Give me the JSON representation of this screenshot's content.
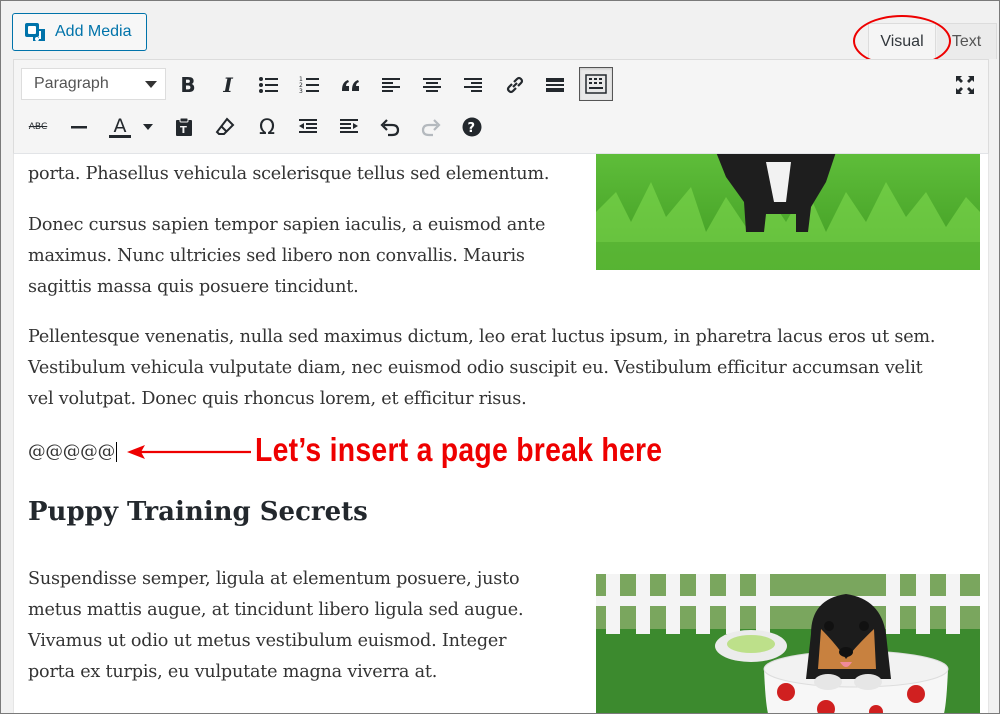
{
  "add_media": {
    "label": "Add Media",
    "icon": "media-icon"
  },
  "tabs": [
    {
      "label": "Visual",
      "active": true
    },
    {
      "label": "Text",
      "active": false
    }
  ],
  "toolbar": {
    "format_select": "Paragraph",
    "row1_icons": [
      "bold-icon",
      "italic-icon",
      "bulleted-list-icon",
      "numbered-list-icon",
      "blockquote-icon",
      "align-left-icon",
      "align-center-icon",
      "align-right-icon",
      "link-icon",
      "read-more-icon",
      "toolbar-toggle-icon",
      "fullscreen-icon"
    ],
    "row2_icons": [
      "strikethrough-icon",
      "horizontal-line-icon",
      "text-color-icon",
      "paste-as-text-icon",
      "clear-formatting-icon",
      "special-character-icon",
      "outdent-icon",
      "indent-icon",
      "undo-icon",
      "redo-icon",
      "help-icon"
    ],
    "labels": {
      "bold": "B",
      "italic": "I",
      "text_color": "A",
      "special_char": "Ω",
      "strike": "ABC"
    }
  },
  "content": {
    "para1": [
      "porta. Phasellus vehicula scelerisque tellus sed elementum."
    ],
    "para2": [
      "Donec cursus sapien tempor sapien iaculis, a euismod ante",
      "maximus. Nunc ultricies sed libero non convallis. Mauris",
      "sagittis massa quis posuere tincidunt."
    ],
    "para3": [
      "Pellentesque venenatis, nulla sed maximus dictum, leo erat luctus ipsum, in pharetra lacus eros ut sem.",
      "Vestibulum vehicula vulputate diam, nec euismod odio suscipit eu. Vestibulum efficitur accumsan velit",
      "vel volutpat. Donec quis rhoncus lorem, et efficitur risus."
    ],
    "marker": "@@@@@",
    "heading": "Puppy Training Secrets",
    "para4": [
      "Suspendisse semper, ligula at elementum posuere, justo",
      "metus mattis augue, at tincidunt libero ligula sed augue.",
      "Vivamus ut odio ut metus vestibulum euismod. Integer",
      "porta ex turpis, eu vulputate magna viverra at."
    ]
  },
  "annotation": {
    "text": "Let’s insert a page break here",
    "color": "#ee0000"
  },
  "colors": {
    "accent": "#0073aa",
    "annotation": "#ee0000"
  }
}
